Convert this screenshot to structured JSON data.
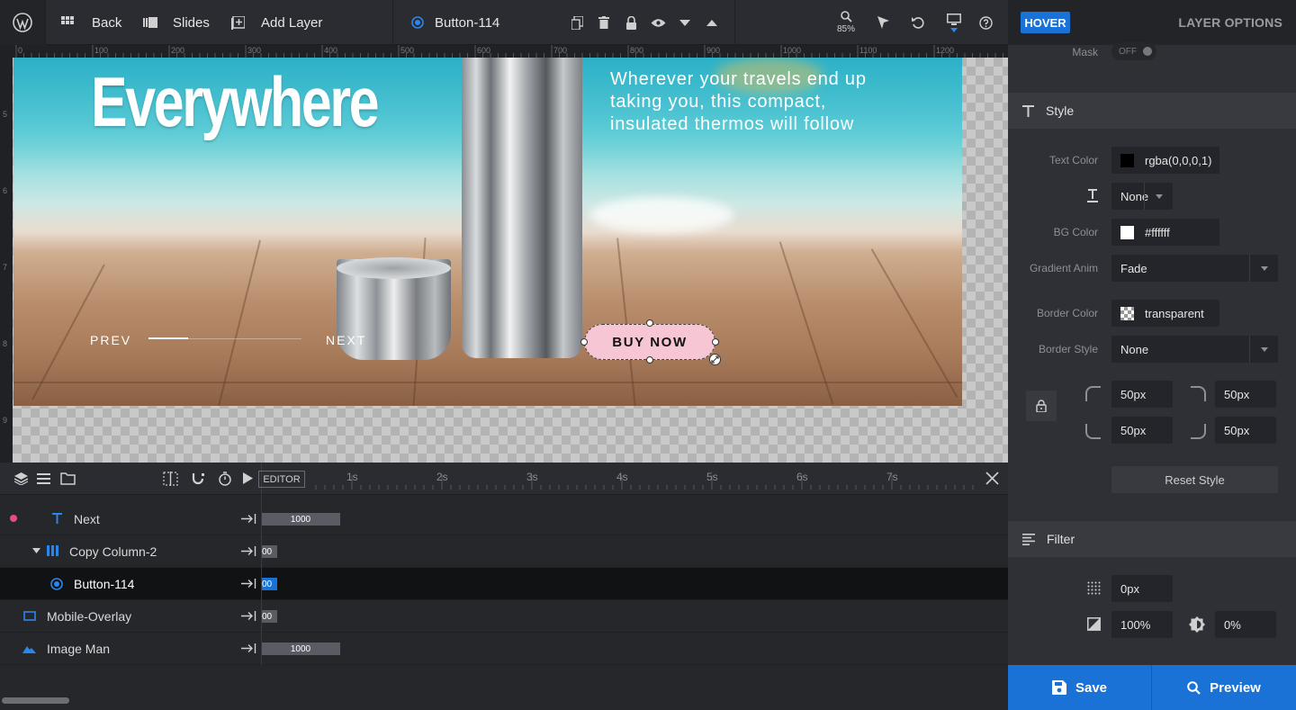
{
  "topbar": {
    "back_label": "Back",
    "slides_label": "Slides",
    "add_layer_label": "Add Layer",
    "current_layer": "Button-114",
    "zoom": "85%"
  },
  "ruler": {
    "top_marks": [
      "0",
      "100",
      "200",
      "300",
      "400",
      "500",
      "600",
      "700",
      "800",
      "900",
      "1000",
      "1100",
      "1200"
    ],
    "left_marks": [
      "5",
      "6",
      "7",
      "8",
      "9"
    ]
  },
  "slide": {
    "headline": "Everywhere",
    "tagline": "Wherever your travels end up taking you, this compact, insulated thermos will follow",
    "prev_label": "PREV",
    "next_label": "NEXT",
    "button_label": "BUY NOW"
  },
  "timeline": {
    "editor_label": "EDITOR",
    "ticks": [
      "1s",
      "2s",
      "3s",
      "4s",
      "5s",
      "6s",
      "7s"
    ],
    "layers": [
      {
        "name": "Next",
        "bar": "1000"
      },
      {
        "name": "Copy Column-2",
        "bar": "00"
      },
      {
        "name": "Button-114",
        "bar": "00"
      },
      {
        "name": "Mobile-Overlay",
        "bar": "00"
      },
      {
        "name": "Image Man",
        "bar": "1000"
      }
    ]
  },
  "panel": {
    "mode_badge": "HOVER",
    "title": "LAYER OPTIONS",
    "mask_label": "Mask",
    "mask_value": "OFF",
    "style_section": "Style",
    "text_color_label": "Text Color",
    "text_color_value": "rgba(0,0,0,1)",
    "text_deco_value": "None",
    "bg_color_label": "BG Color",
    "bg_color_value": "#ffffff",
    "gradient_anim_label": "Gradient Anim",
    "gradient_anim_value": "Fade",
    "border_color_label": "Border Color",
    "border_color_value": "transparent",
    "border_style_label": "Border Style",
    "border_style_value": "None",
    "radius_tl": "50px",
    "radius_tr": "50px",
    "radius_bl": "50px",
    "radius_br": "50px",
    "reset_style_label": "Reset Style",
    "filter_section": "Filter",
    "blur_value": "0px",
    "grayscale_value": "100%",
    "brightness_value": "0%",
    "save_label": "Save",
    "preview_label": "Preview"
  },
  "colors": {
    "accent": "#1a72d6",
    "button_bg": "#f7c6d5",
    "text_swatch": "#000000",
    "bg_swatch": "#ffffff"
  }
}
